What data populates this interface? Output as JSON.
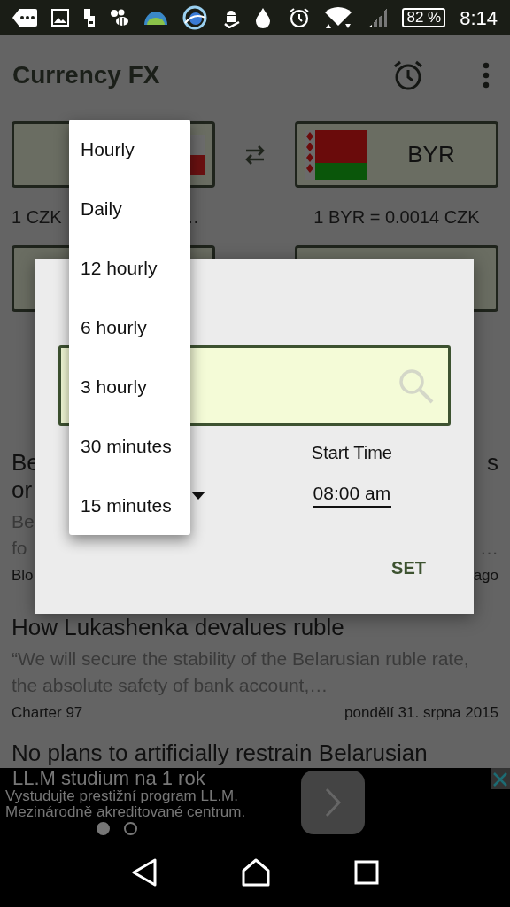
{
  "status_bar": {
    "battery": "82 %",
    "time": "8:14"
  },
  "app_bar": {
    "title": "Currency FX"
  },
  "converter": {
    "to": {
      "code": "BYR"
    },
    "from_rate": {
      "text": "1 CZK",
      "tail": "…"
    },
    "to_rate": "1 BYR = 0.0014 CZK"
  },
  "news": [
    {
      "kind": "covered",
      "title": [
        {
          "left": "Be",
          "right": "s"
        },
        {
          "left": "or"
        }
      ],
      "summary": [
        {
          "left": "Be"
        },
        {
          "left": "fo",
          "right": "…"
        }
      ],
      "source": "Blo",
      "time": "ago"
    },
    {
      "kind": "full",
      "title": "How Lukashenka devalues ruble",
      "summary": "“We will secure the stability of the Belarusian ruble rate, the absolute safety of bank account,…",
      "source": "Charter 97",
      "time": "pondělí 31. srpna 2015"
    },
    {
      "kind": "cut",
      "title": "No plans to artificially restrain Belarusian"
    }
  ],
  "dialog": {
    "start_time": {
      "label": "Start Time",
      "value": "08:00 am"
    },
    "set_button": "SET"
  },
  "dropdown": {
    "options": [
      "Hourly",
      "Daily",
      "12 hourly",
      "6 hourly",
      "3 hourly",
      "30 minutes",
      "15 minutes"
    ]
  },
  "ad": {
    "title": "LL.M studium na 1 rok",
    "lines": [
      "Vystudujte prestižní program LL.M.",
      "Mezinárodně akreditované centrum."
    ],
    "pages": [
      {
        "selected": true
      },
      {
        "selected": false
      }
    ]
  }
}
